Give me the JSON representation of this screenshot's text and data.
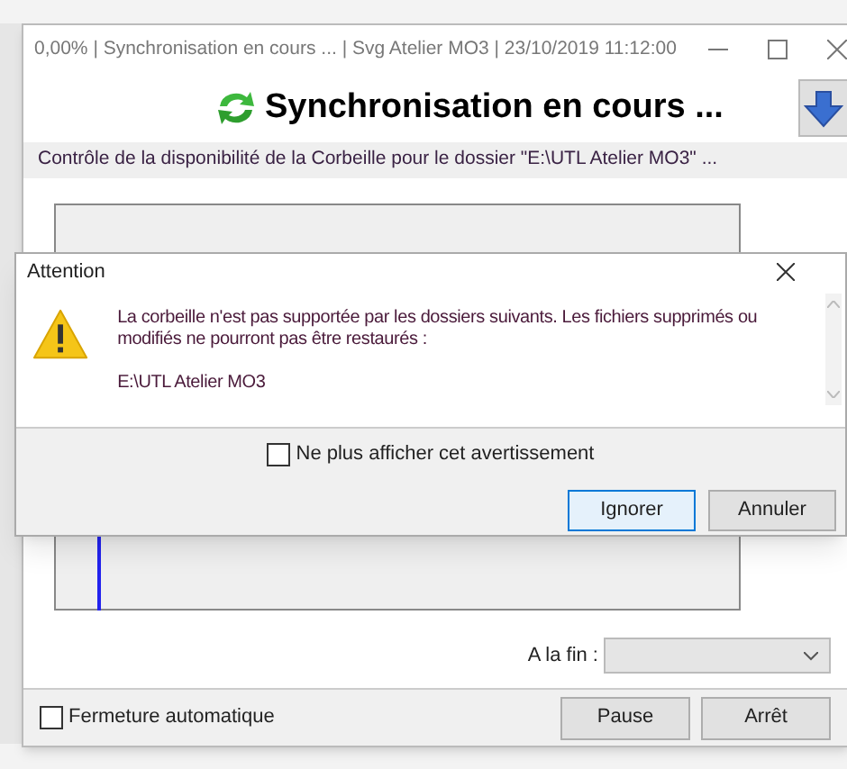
{
  "main_window": {
    "title": "0,00% | Synchronisation en cours ... | Svg Atelier MO3 | 23/10/2019 11:12:00",
    "heading": "Synchronisation en cours ...",
    "status": "Contrôle de la disponibilité de la Corbeille pour le dossier \"E:\\UTL Atelier MO3\" ...",
    "end_action_label": "A la fin :",
    "auto_close": {
      "label": "Fermeture automatique",
      "checked": false
    },
    "buttons": [
      "Pause",
      "Arrêt"
    ]
  },
  "dialog": {
    "title": "Attention",
    "message": "La corbeille n'est pas supportée par les dossiers suivants. Les fichiers supprimés ou modifiés ne pourront pas être restaurés :",
    "folders": [
      "E:\\UTL Atelier MO3"
    ],
    "dont_show_again": {
      "label": "Ne plus afficher cet avertissement",
      "checked": false
    },
    "buttons": [
      {
        "label": "Ignorer",
        "default": true
      },
      {
        "label": "Annuler",
        "default": false
      }
    ]
  }
}
